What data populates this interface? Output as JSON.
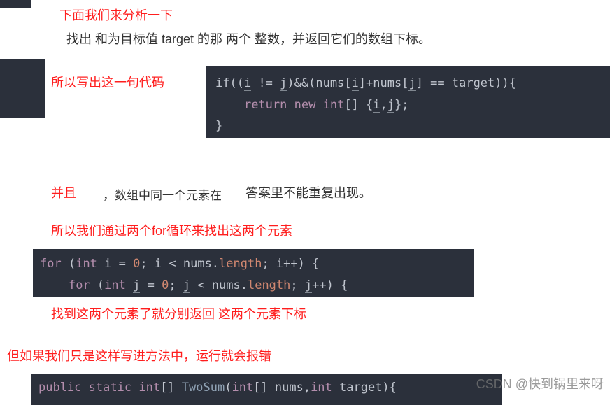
{
  "text": {
    "analysis_intro": "下面我们来分析一下",
    "problem_desc": "找出 和为目标值 target 的那 两个 整数，并返回它们的数组下标。",
    "so_write_code": "所以写出这一句代码",
    "and_label": "并且",
    "comma_prefix": "，数组中同一个元素在",
    "answer_norepeat": "答案里不能重复出现。",
    "so_two_for": "所以我们通过两个for循环来找出这两个元素",
    "found_return": "找到这两个元素了就分别返回 这两个元素下标",
    "but_error": "但如果我们只是这样写进方法中，运行就会报错"
  },
  "code1": {
    "l1_a": "if((",
    "l1_i": "i",
    "l1_b": " != ",
    "l1_j": "j",
    "l1_c": ")&&(nums[",
    "l1_i2": "i",
    "l1_d": "]+nums[",
    "l1_j2": "j",
    "l1_e": "] == target)){",
    "l2_a": "    ",
    "l2_ret": "return",
    "l2_b": " ",
    "l2_new": "new",
    "l2_c": " ",
    "l2_int": "int",
    "l2_d": "[] {",
    "l2_i": "i",
    "l2_e": ",",
    "l2_j": "j",
    "l2_f": "};",
    "l3": "}"
  },
  "code2": {
    "l1_for": "for",
    "l1_a": " (",
    "l1_int": "int",
    "l1_b": " ",
    "l1_i": "i",
    "l1_c": " = ",
    "l1_zero": "0",
    "l1_d": "; ",
    "l1_i2": "i",
    "l1_e": " < nums.",
    "l1_len": "length",
    "l1_f": "; ",
    "l1_i3": "i",
    "l1_g": "++) {",
    "l2_indent": "    ",
    "l2_for": "for",
    "l2_a": " (",
    "l2_int": "int",
    "l2_b": " ",
    "l2_j": "j",
    "l2_c": " = ",
    "l2_zero": "0",
    "l2_d": "; ",
    "l2_j2": "j",
    "l2_e": " < nums.",
    "l2_len": "length",
    "l2_f": "; ",
    "l2_j3": "j",
    "l2_g": "++) {"
  },
  "code3": {
    "l1_public": "public",
    "l1_sp1": " ",
    "l1_static": "static",
    "l1_sp2": " ",
    "l1_int": "int",
    "l1_a": "[] ",
    "l1_fn": "TwoSum",
    "l1_b": "(",
    "l1_int2": "int",
    "l1_c": "[] nums,",
    "l1_int3": "int",
    "l1_d": " target){"
  },
  "watermark": "CSDN @快到锅里来呀"
}
